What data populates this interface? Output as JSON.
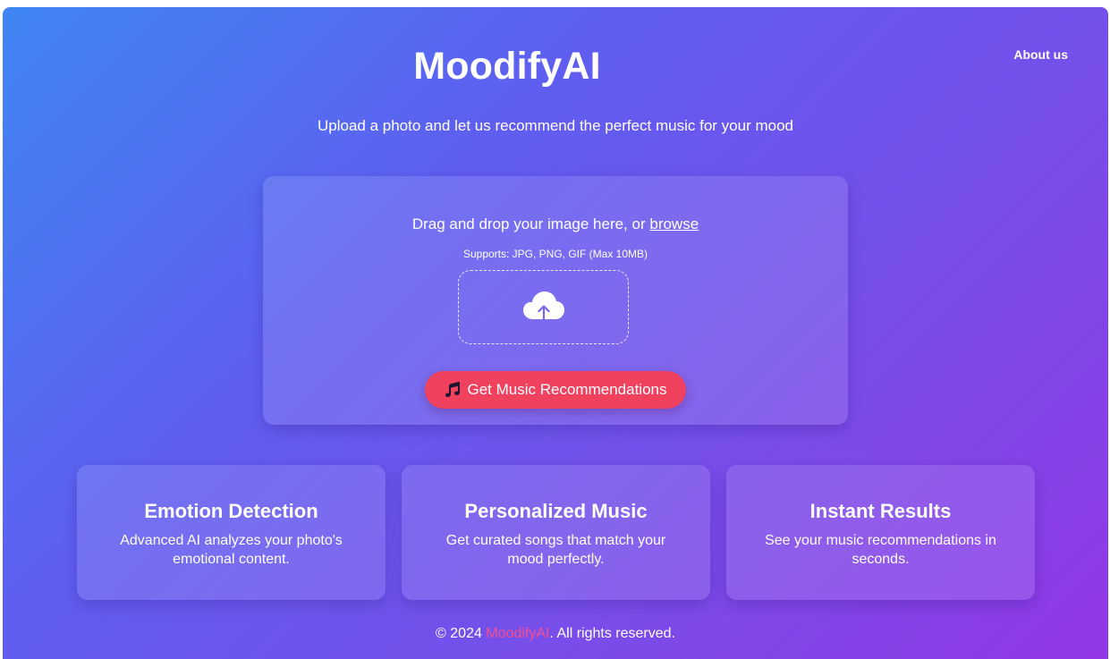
{
  "header": {
    "title": "MoodifyAI",
    "nav_about": "About us",
    "subtitle": "Upload a photo and let us recommend the perfect music for your mood"
  },
  "upload": {
    "drop_text": "Drag and drop your image here, or",
    "browse_label": "browse",
    "supports": "Supports: JPG, PNG, GIF (Max 10MB)",
    "dropzone_icon": "cloud-upload-icon",
    "button_icon": "music-note-icon",
    "button_label": "Get Music Recommendations"
  },
  "features": [
    {
      "title": "Emotion Detection",
      "description": "Advanced AI analyzes your photo's emotional content."
    },
    {
      "title": "Personalized Music",
      "description": "Get curated songs that match your mood perfectly."
    },
    {
      "title": "Instant Results",
      "description": "See your music recommendations in seconds."
    }
  ],
  "footer": {
    "prefix": "© 2024",
    "brand": "MoodifyAI",
    "suffix": ". All rights reserved."
  },
  "colors": {
    "gradient_start": "#3f86f4",
    "gradient_end": "#9237e6",
    "accent_button": "#f0415f",
    "footer_brand": "#f74f8e"
  }
}
